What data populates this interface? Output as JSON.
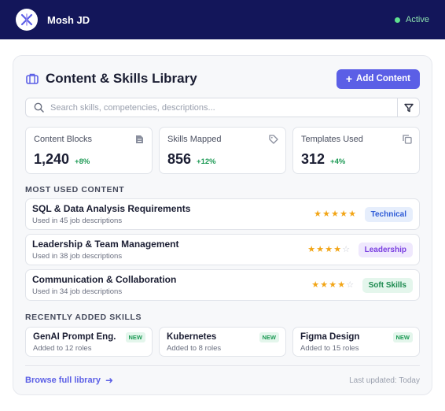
{
  "topbar": {
    "brand": "Mosh JD",
    "status": "Active"
  },
  "library": {
    "title": "Content & Skills Library",
    "add_button": "Add Content",
    "search_placeholder": "Search skills, competencies, descriptions..."
  },
  "stats": [
    {
      "label": "Content Blocks",
      "value": "1,240",
      "delta": "+8%",
      "icon": "document-icon"
    },
    {
      "label": "Skills Mapped",
      "value": "856",
      "delta": "+12%",
      "icon": "tag-icon"
    },
    {
      "label": "Templates Used",
      "value": "312",
      "delta": "+4%",
      "icon": "copy-icon"
    }
  ],
  "most_used": {
    "heading": "MOST USED CONTENT",
    "items": [
      {
        "title": "SQL & Data Analysis Requirements",
        "usage": "Used in 45 job descriptions",
        "rating": 5,
        "tag": "Technical"
      },
      {
        "title": "Leadership & Team Management",
        "usage": "Used in 38 job descriptions",
        "rating": 4,
        "tag": "Leadership"
      },
      {
        "title": "Communication & Collaboration",
        "usage": "Used in 34 job descriptions",
        "rating": 4,
        "tag": "Soft Skills"
      }
    ]
  },
  "recent_skills": {
    "heading": "RECENTLY ADDED SKILLS",
    "items": [
      {
        "name": "GenAI Prompt Eng.",
        "sub": "Added to 12 roles",
        "badge": "NEW"
      },
      {
        "name": "Kubernetes",
        "sub": "Added to 8 roles",
        "badge": "NEW"
      },
      {
        "name": "Figma Design",
        "sub": "Added to 15 roles",
        "badge": "NEW"
      }
    ]
  },
  "footer": {
    "browse": "Browse full library",
    "updated": "Last updated: Today"
  },
  "colors": {
    "accent": "#5b5fe6",
    "topbar": "#13165a",
    "positive": "#1d9a55",
    "star": "#f2a516"
  }
}
